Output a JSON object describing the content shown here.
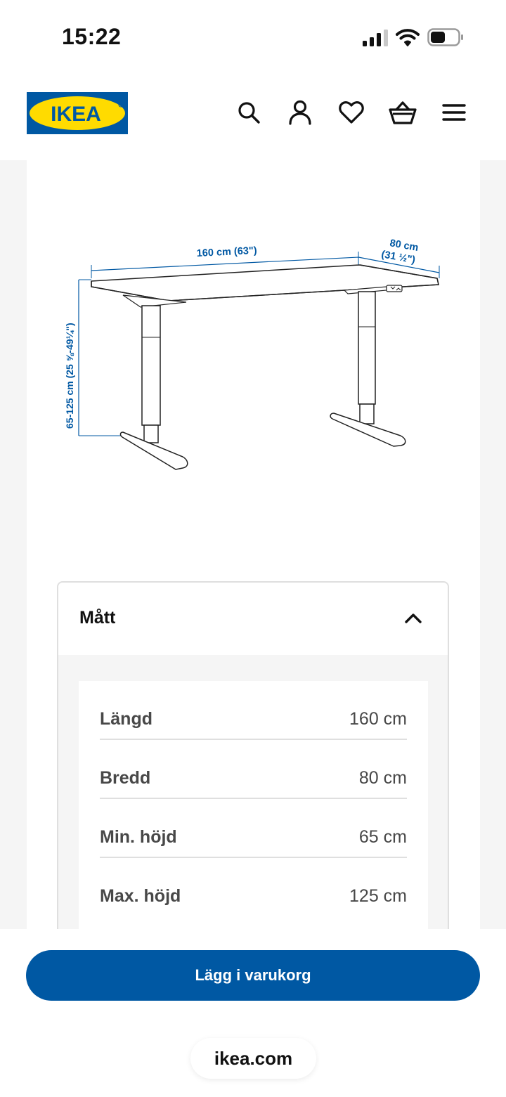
{
  "status_bar": {
    "time": "15:22",
    "icons": [
      "cellular-signal-icon",
      "wifi-icon",
      "battery-icon"
    ]
  },
  "header": {
    "logo_text": "IKEA",
    "brand_colors": {
      "blue": "#0058a3",
      "yellow": "#ffdb00"
    },
    "icons": [
      "search-icon",
      "account-icon",
      "heart-icon",
      "shopping-basket-icon",
      "menu-icon"
    ]
  },
  "product_image": {
    "width_label": "160 cm (63\")",
    "depth_label_top": "80 cm",
    "depth_label_bottom": "(31 ½\")",
    "height_label": "65-125 cm (25 ⅝-49¼\")",
    "label_color": "#0058a3"
  },
  "dimensions": {
    "title": "Mått",
    "expanded": true,
    "rows": [
      {
        "label": "Längd",
        "value": "160 cm"
      },
      {
        "label": "Bredd",
        "value": "80 cm"
      },
      {
        "label": "Min. höjd",
        "value": "65 cm"
      },
      {
        "label": "Max. höjd",
        "value": "125 cm"
      }
    ]
  },
  "actions": {
    "add_to_cart_label": "Lägg i varukorg"
  },
  "browser": {
    "url": "ikea.com"
  }
}
